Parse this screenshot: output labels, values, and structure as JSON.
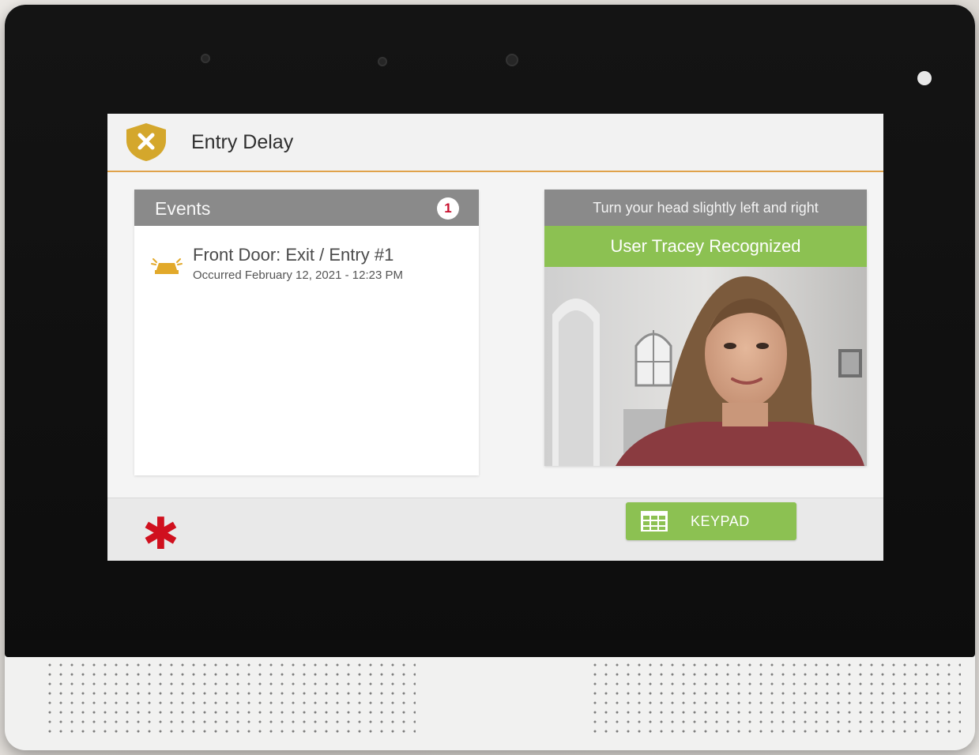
{
  "header": {
    "title": "Entry Delay",
    "status_icon": "shield-x-icon",
    "accent_color": "#d4a72c",
    "divider_color": "#e0a24a"
  },
  "events": {
    "title": "Events",
    "badge_count": "1",
    "items": [
      {
        "icon": "door-alert-icon",
        "name": "Front Door: Exit / Entry #1",
        "time": "Occurred February 12, 2021 - 12:23 PM"
      }
    ]
  },
  "camera": {
    "instruction": "Turn your head slightly left and right",
    "recognized": "User Tracey Recognized",
    "recognized_color": "#8cc152"
  },
  "footer": {
    "emergency_icon": "asterisk-icon",
    "emergency_color": "#d0101e",
    "keypad_label": "KEYPAD",
    "keypad_icon": "keypad-grid-icon"
  }
}
